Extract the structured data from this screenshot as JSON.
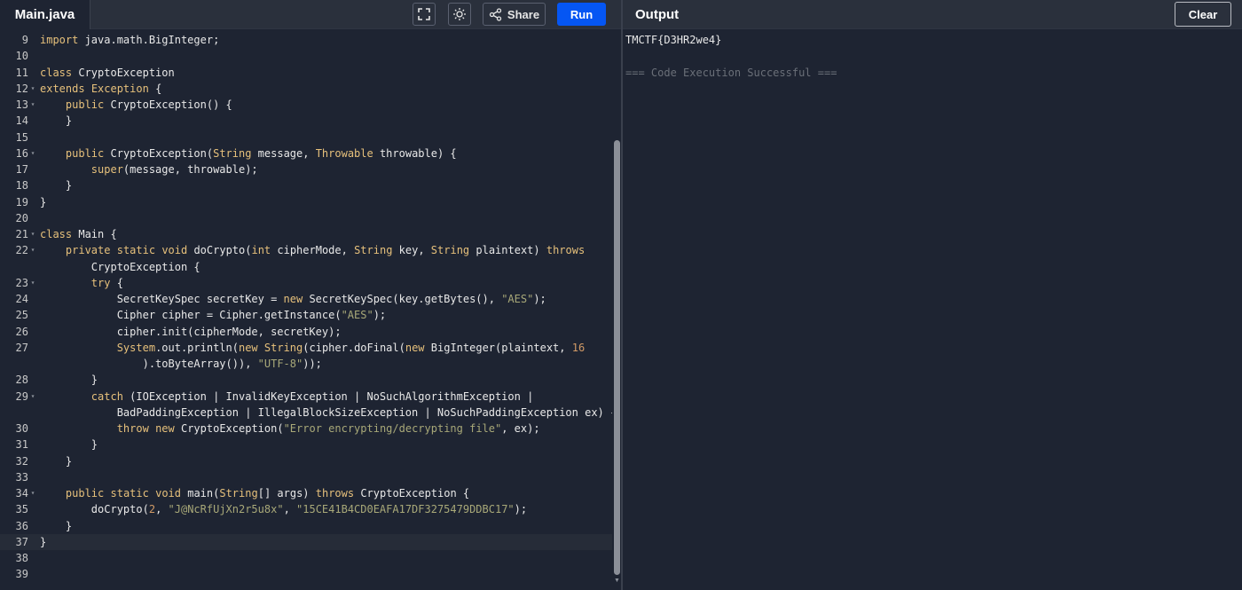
{
  "editor": {
    "file_tab": "Main.java",
    "share_label": "Share",
    "run_label": "Run",
    "icons": {
      "fullscreen": "fullscreen-icon",
      "theme": "sun-icon",
      "share": "share-icon"
    },
    "lines": [
      {
        "n": "9",
        "fold": false,
        "html": "<span class=\"kw\">import</span> java.math.BigInteger;"
      },
      {
        "n": "10",
        "fold": false,
        "html": ""
      },
      {
        "n": "11",
        "fold": false,
        "html": "<span class=\"kw\">class</span> CryptoException"
      },
      {
        "n": "12",
        "fold": true,
        "html": "<span class=\"kw\">extends</span> <span class=\"kw\">Exception</span> {"
      },
      {
        "n": "13",
        "fold": true,
        "html": "    <span class=\"kw\">public</span> CryptoException() {"
      },
      {
        "n": "14",
        "fold": false,
        "html": "    }"
      },
      {
        "n": "15",
        "fold": false,
        "html": ""
      },
      {
        "n": "16",
        "fold": true,
        "html": "    <span class=\"kw\">public</span> CryptoException(<span class=\"kw\">String</span> message, <span class=\"kw\">Throwable</span> throwable) {"
      },
      {
        "n": "17",
        "fold": false,
        "html": "        <span class=\"kw\">super</span>(message, throwable);"
      },
      {
        "n": "18",
        "fold": false,
        "html": "    }"
      },
      {
        "n": "19",
        "fold": false,
        "html": "}"
      },
      {
        "n": "20",
        "fold": false,
        "html": ""
      },
      {
        "n": "21",
        "fold": true,
        "html": "<span class=\"kw\">class</span> Main {"
      },
      {
        "n": "22",
        "fold": true,
        "html": "    <span class=\"kw\">private</span> <span class=\"kw\">static</span> <span class=\"kw\">void</span> doCrypto(<span class=\"kw\">int</span> cipherMode, <span class=\"kw\">String</span> key, <span class=\"kw\">String</span> plaintext) <span class=\"kw\">throws</span>"
      },
      {
        "n": "",
        "fold": false,
        "html": "        CryptoException {"
      },
      {
        "n": "23",
        "fold": true,
        "html": "        <span class=\"kw\">try</span> {"
      },
      {
        "n": "24",
        "fold": false,
        "html": "            SecretKeySpec secretKey = <span class=\"kw\">new</span> SecretKeySpec(key.getBytes(), <span class=\"str\">\"AES\"</span>);"
      },
      {
        "n": "25",
        "fold": false,
        "html": "            Cipher cipher = Cipher.getInstance(<span class=\"str\">\"AES\"</span>);"
      },
      {
        "n": "26",
        "fold": false,
        "html": "            cipher.init(cipherMode, secretKey);"
      },
      {
        "n": "27",
        "fold": false,
        "html": "            <span class=\"kw\">System</span>.out.println(<span class=\"kw\">new</span> <span class=\"kw\">String</span>(cipher.doFinal(<span class=\"kw\">new</span> BigInteger(plaintext, <span class=\"num\">16</span>"
      },
      {
        "n": "",
        "fold": false,
        "html": "                ).toByteArray()), <span class=\"str\">\"UTF-8\"</span>));"
      },
      {
        "n": "28",
        "fold": false,
        "html": "        }"
      },
      {
        "n": "29",
        "fold": true,
        "html": "        <span class=\"kw\">catch</span> (IOException | InvalidKeyException | NoSuchAlgorithmException |"
      },
      {
        "n": "",
        "fold": false,
        "html": "            BadPaddingException | IllegalBlockSizeException | NoSuchPaddingException ex) {"
      },
      {
        "n": "30",
        "fold": false,
        "html": "            <span class=\"kw\">throw</span> <span class=\"kw\">new</span> CryptoException(<span class=\"str\">\"Error encrypting/decrypting file\"</span>, ex);"
      },
      {
        "n": "31",
        "fold": false,
        "html": "        }"
      },
      {
        "n": "32",
        "fold": false,
        "html": "    }"
      },
      {
        "n": "33",
        "fold": false,
        "html": ""
      },
      {
        "n": "34",
        "fold": true,
        "html": "    <span class=\"kw\">public</span> <span class=\"kw\">static</span> <span class=\"kw\">void</span> main(<span class=\"kw\">String</span>[] args) <span class=\"kw\">throws</span> CryptoException {"
      },
      {
        "n": "35",
        "fold": false,
        "html": "        doCrypto(<span class=\"num\">2</span>, <span class=\"str\">\"J@NcRfUjXn2r5u8x\"</span>, <span class=\"str\">\"15CE41B4CD0EAFA17DF3275479DDBC17\"</span>);"
      },
      {
        "n": "36",
        "fold": false,
        "html": "    }"
      },
      {
        "n": "37",
        "fold": false,
        "html": "}",
        "active": true
      },
      {
        "n": "38",
        "fold": false,
        "html": ""
      },
      {
        "n": "39",
        "fold": false,
        "html": ""
      }
    ]
  },
  "output": {
    "title": "Output",
    "clear_label": "Clear",
    "lines": [
      "TMCTF{D3HR2we4}",
      ""
    ],
    "status": "=== Code Execution Successful ==="
  }
}
